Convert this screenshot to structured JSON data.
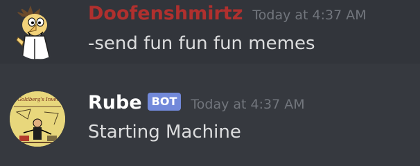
{
  "messages": [
    {
      "username": "Doofenshmirtz",
      "username_color": "#b0302e",
      "timestamp": "Today at 4:37 AM",
      "content": "-send fun fun fun memes",
      "avatar_icon": "doofenshmirtz-avatar"
    },
    {
      "username": "Rube",
      "username_color": "#ffffff",
      "bot_tag": "BOT",
      "timestamp": "Today at 4:37 AM",
      "content": "Starting Machine",
      "avatar_icon": "rube-goldberg-avatar",
      "avatar_text": "Rube Goldberg's Inventions"
    }
  ],
  "colors": {
    "background": "#36393f",
    "highlight_row": "#32353b",
    "timestamp": "#72767d",
    "message_text": "#dcddde",
    "bot_tag_bg": "#7289da"
  }
}
